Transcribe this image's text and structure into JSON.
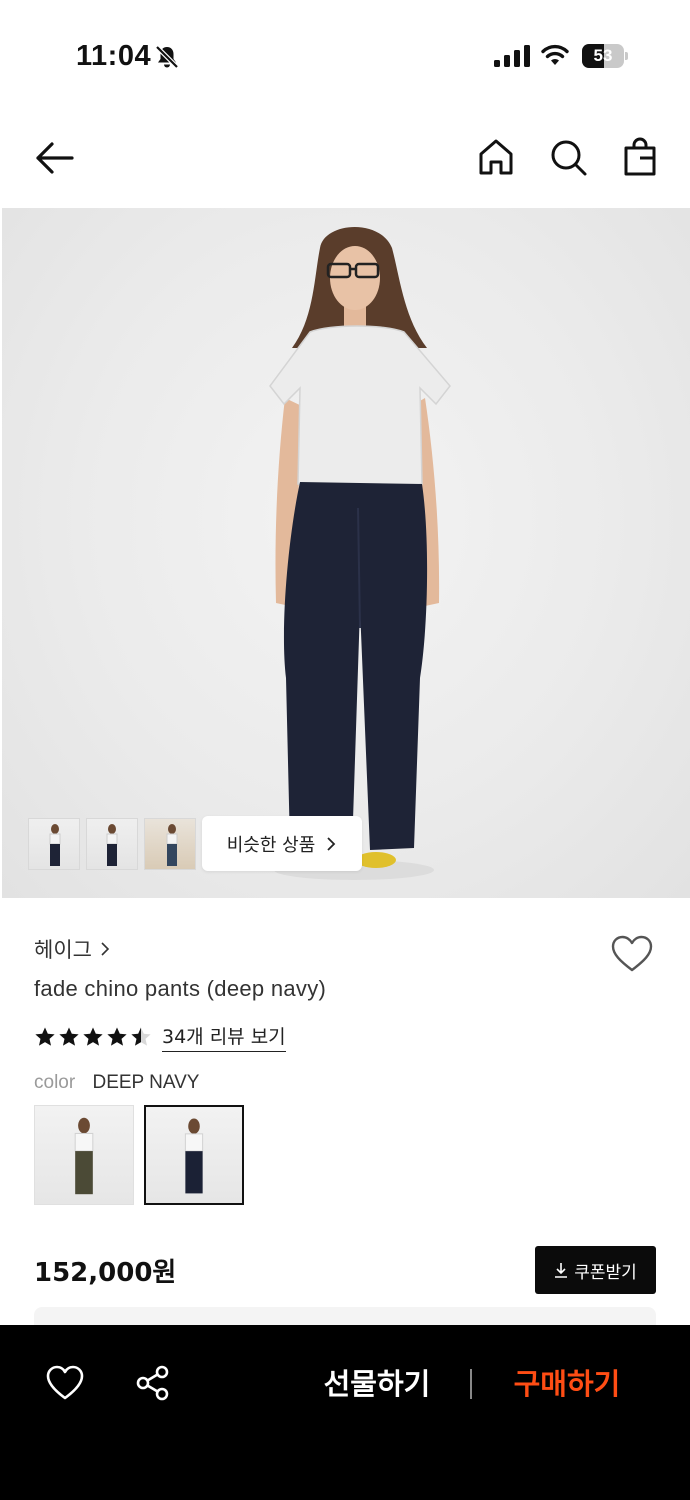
{
  "status_bar": {
    "time": "11:04",
    "battery_level": "53",
    "battery_fraction": 0.53
  },
  "header": {
    "icons": [
      "back-arrow-icon",
      "home-icon",
      "search-icon",
      "shopping-bag-icon"
    ]
  },
  "hero": {
    "similar_label": "비슷한 상품",
    "thumbnail_count": 3
  },
  "product": {
    "brand": "헤이그",
    "name": "fade chino pants (deep navy)",
    "rating": 4.5,
    "review_link": "34개 리뷰 보기",
    "color_label": "color",
    "color_value": "DEEP NAVY",
    "price": "152,000원",
    "coupon_label": "쿠폰받기"
  },
  "colors": {
    "buy_accent": "#ff4d14",
    "bottom_bar": "#000000",
    "swatch_1_pants": "#4b4a36",
    "swatch_2_pants": "#1b2135"
  },
  "bottom_bar": {
    "gift_label": "선물하기",
    "buy_label": "구매하기"
  }
}
